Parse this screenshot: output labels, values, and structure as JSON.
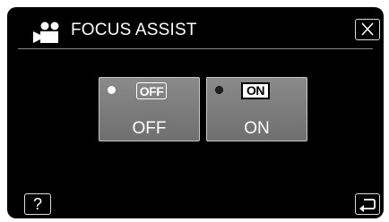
{
  "header": {
    "title": "FOCUS ASSIST",
    "mode_icon": "video-camera-icon",
    "close_icon": "close-icon"
  },
  "options": [
    {
      "badge": "OFF",
      "label": "OFF",
      "selected": false
    },
    {
      "badge": "ON",
      "label": "ON",
      "selected": true
    }
  ],
  "footer": {
    "help_label": "?",
    "back_icon": "return-arrow-icon"
  },
  "colors": {
    "panel_background": "#000000",
    "option_background": "#7d7d7d",
    "text": "#ffffff",
    "border": "#dcdcdc"
  }
}
